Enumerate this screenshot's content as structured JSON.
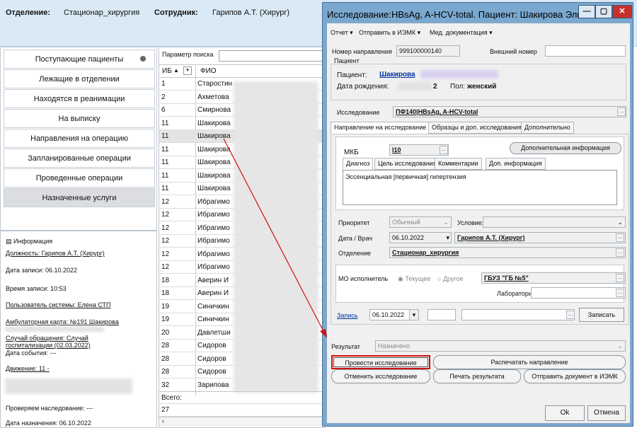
{
  "header": {
    "dept_label": "Отделение:",
    "dept_value": "Стационар_хирургия",
    "emp_label": "Сотрудник:",
    "emp_value": "Гарипов А.Т. (Хирург)"
  },
  "nav": [
    "Поступающие пациенты",
    "Лежащие в отделении",
    "Находятся в реанимации",
    "На выписку",
    "Направления на операцию",
    "Запланированные операции",
    "Проведенные операции",
    "Назначенные услуги"
  ],
  "info": {
    "title": "Информация",
    "position": "Должность: Гарипов А.Т. (Хирург)",
    "date": "Дата записи: 06.10.2022",
    "time": "Время записи: 10:53",
    "user": "Пользователь системы: Елена  СТП",
    "card": "Амбулаторная карта: №191 Шакирова",
    "case1": "Случай обращения: Случай",
    "case2": "госпитализации (02.03.2022)",
    "event": "Дата события: ---",
    "move": "Движение: 11 -",
    "inherit": "Проверяем наследование: ---",
    "assign": "Дата назначения: 06.10.2022"
  },
  "table": {
    "search_label": "Параметр поиска",
    "col1": "ИБ",
    "col2": "ФИО",
    "rows": [
      [
        "1",
        "Старостин"
      ],
      [
        "2",
        "Ахметова"
      ],
      [
        "6",
        "Смирнова"
      ],
      [
        "11",
        "Шакирова"
      ],
      [
        "11",
        "Шакирова"
      ],
      [
        "11",
        "Шакирова"
      ],
      [
        "11",
        "Шакирова"
      ],
      [
        "11",
        "Шакирова"
      ],
      [
        "11",
        "Шакирова"
      ],
      [
        "12",
        "Ибрагимо"
      ],
      [
        "12",
        "Ибрагимо"
      ],
      [
        "12",
        "Ибрагимо"
      ],
      [
        "12",
        "Ибрагимо"
      ],
      [
        "12",
        "Ибрагимо"
      ],
      [
        "12",
        "Ибрагимо"
      ],
      [
        "18",
        "Аверин И"
      ],
      [
        "18",
        "Аверин И"
      ],
      [
        "19",
        "Синичкин"
      ],
      [
        "19",
        "Синичкин"
      ],
      [
        "20",
        "Давлетши"
      ],
      [
        "28",
        "Сидоров"
      ],
      [
        "28",
        "Сидоров"
      ],
      [
        "28",
        "Сидоров"
      ],
      [
        "32",
        "Зарипова"
      ]
    ],
    "total_label": "Всего:",
    "total_value": "27"
  },
  "dialog": {
    "title": "Исследование:HBsAg, A-HCV-total. Пациент: Шакирова Эльви...",
    "menu": [
      "Отчет ▾",
      "Отправить в ИЭМК ▾",
      "Мед. документация ▾"
    ],
    "referral_no_label": "Номер направления",
    "referral_no": "999100000140",
    "ext_no_label": "Внешний номер",
    "patient_group": "Пациент",
    "patient_label": "Пациент:",
    "patient_name": "Шакирова",
    "dob_label": "Дата рождения:",
    "dob_tail": "2",
    "sex_label": "Пол:",
    "sex": "женский",
    "study_label": "Исследование",
    "study_value": "ПФ140|HBsAg, A-HCV-total",
    "tabs": [
      "Направление на исследование",
      "Образцы и доп. исследования",
      "Дополнительно"
    ],
    "mkb_label": "МКБ",
    "mkb": "I10",
    "addinfo_btn": "Дополнительная информация",
    "subtabs": [
      "Диагноз",
      "Цель исследования",
      "Комментарии",
      "Доп. информация"
    ],
    "diagnosis": "Эссенциальная [первичная] гипертензия",
    "priority_label": "Приоритет",
    "priority": "Обычный",
    "cond_label": "Условие:",
    "date_doc_label": "Дата / Врач",
    "date_doc_date": "06.10.2022",
    "doctor": "Гарипов А.Т. (Хирург)",
    "dept_label": "Отделение",
    "dept": "Стационар_хирургия",
    "mo_label": "МО исполнитель",
    "radio_current": "Текущее",
    "radio_other": "Другое",
    "mo": "ГБУЗ \"ГБ №5\"",
    "lab_label": "Лаборатория",
    "record_link": "Запись",
    "record_date": "06.10.2022",
    "record_btn": "Записать",
    "result_label": "Результат",
    "result": "Назначено",
    "btn_conduct": "Провести исследование",
    "btn_print_ref": "Распечатать направление",
    "btn_cancel_study": "Отменить исследование",
    "btn_print_res": "Печать результата",
    "btn_send": "Отправить документ в ИЭМК",
    "ok": "Ok",
    "cancel": "Отмена"
  },
  "colors": {
    "accent_red": "#d01010",
    "link_blue": "#0033a0",
    "titlebar": "#7aa8cf"
  }
}
